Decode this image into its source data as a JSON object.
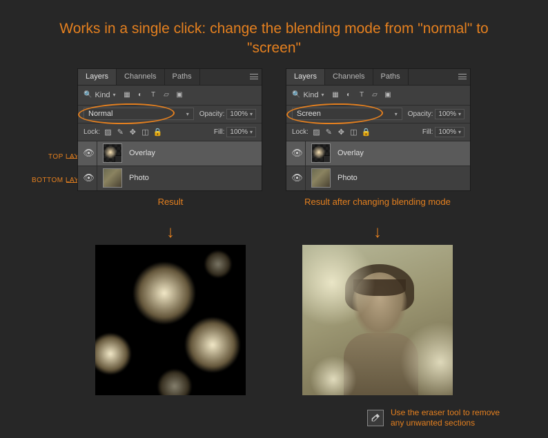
{
  "headline": "Works in a single click: change the blending mode from \"normal\" to \"screen\"",
  "side_labels": {
    "top": "TOP LAYER",
    "bottom": "BOTTOM LAYER"
  },
  "panel": {
    "tabs": {
      "layers": "Layers",
      "channels": "Channels",
      "paths": "Paths"
    },
    "kind": "Kind",
    "opacity_label": "Opacity:",
    "opacity_value": "100%",
    "lock_label": "Lock:",
    "fill_label": "Fill:",
    "fill_value": "100%",
    "layer_overlay": "Overlay",
    "layer_photo": "Photo"
  },
  "left_panel": {
    "blend_mode": "Normal"
  },
  "right_panel": {
    "blend_mode": "Screen"
  },
  "results": {
    "left_label": "Result",
    "right_label": "Result after changing blending mode"
  },
  "eraser_tip": "Use the eraser tool to remove any unwanted sections"
}
